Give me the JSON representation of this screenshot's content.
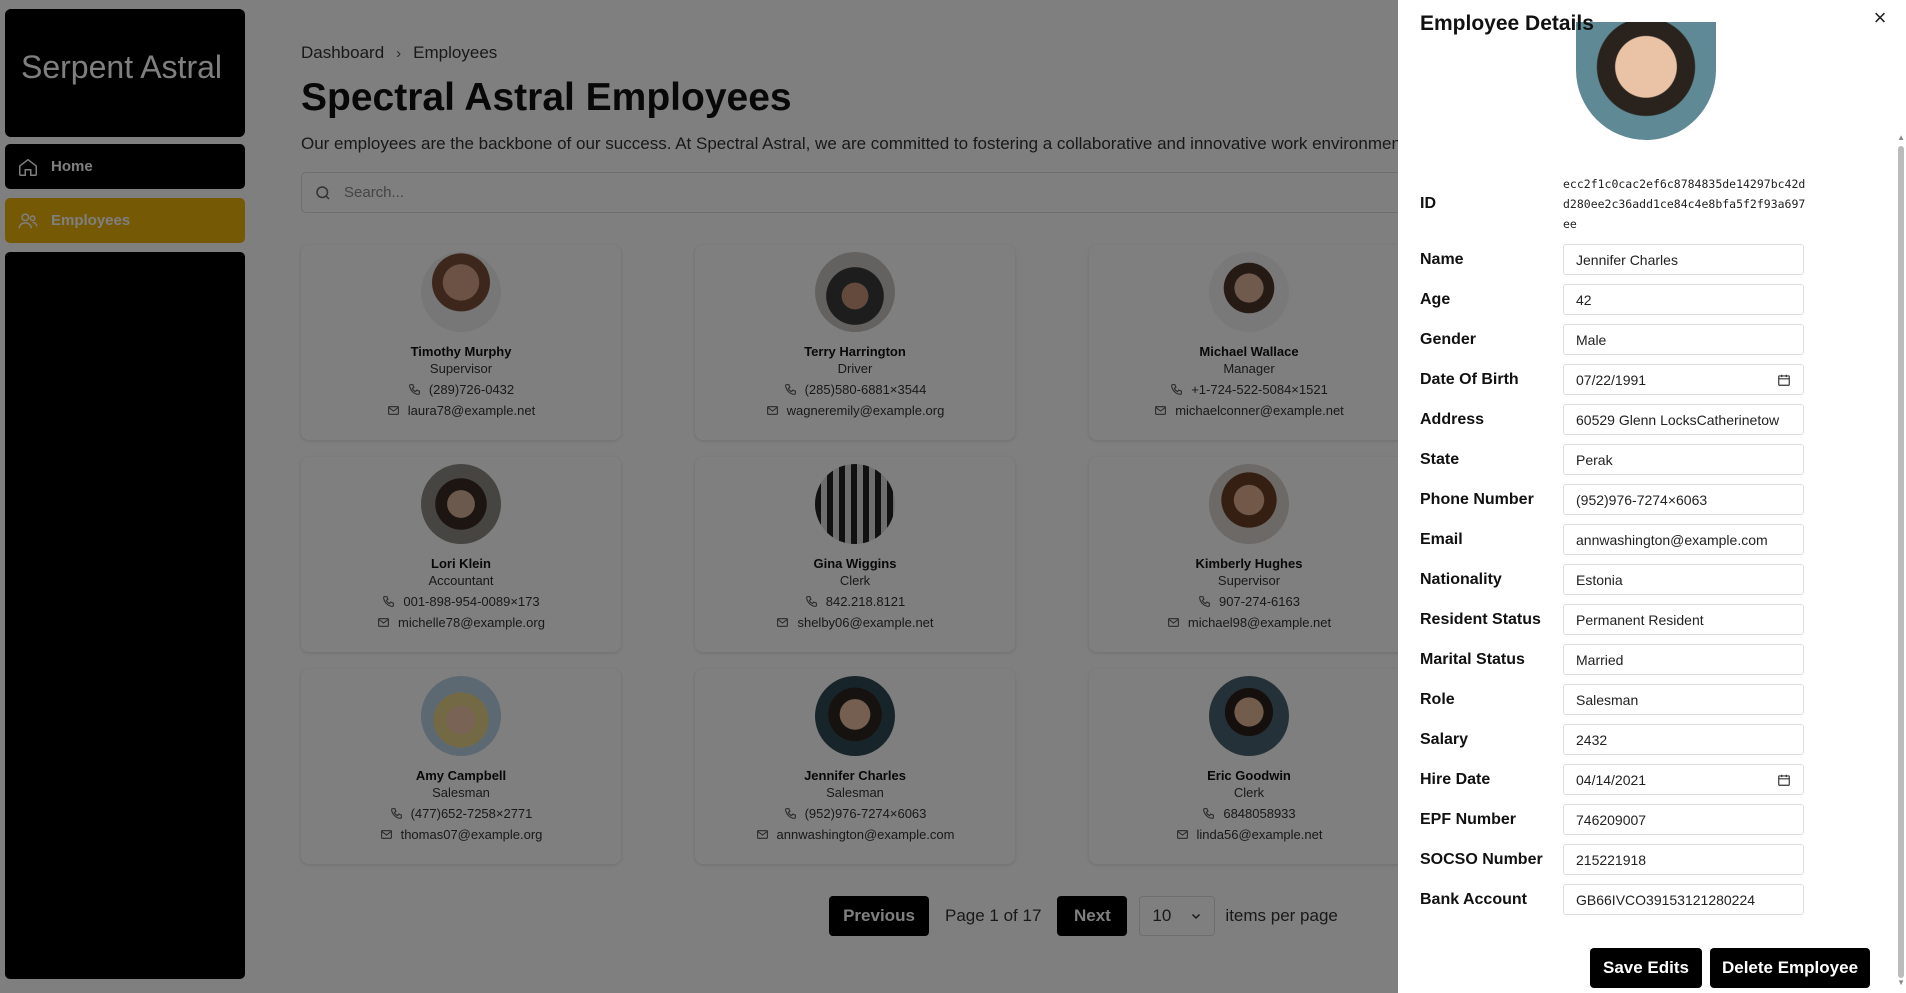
{
  "sidebar": {
    "brand": "Serpent Astral",
    "items": [
      {
        "label": "Home",
        "icon": "home-icon"
      },
      {
        "label": "Employees",
        "icon": "users-icon"
      }
    ],
    "active_color": "#eab308"
  },
  "breadcrumb": [
    "Dashboard",
    "Employees"
  ],
  "page": {
    "title": "Spectral Astral Employees",
    "intro": "Our employees are the backbone of our success. At Spectral Astral, we are committed to fostering a collaborative and innovative work environment"
  },
  "search": {
    "placeholder": "Search..."
  },
  "employees": [
    {
      "name": "Timothy Murphy",
      "role": "Supervisor",
      "phone": "(289)726-0432",
      "email": "laura78@example.net"
    },
    {
      "name": "Terry Harrington",
      "role": "Driver",
      "phone": "(285)580-6881×3544",
      "email": "wagneremily@example.org"
    },
    {
      "name": "Michael Wallace",
      "role": "Manager",
      "phone": "+1-724-522-5084×1521",
      "email": "michaelconner@example.net"
    },
    {
      "name": "Lori Klein",
      "role": "Accountant",
      "phone": "001-898-954-0089×173",
      "email": "michelle78@example.org"
    },
    {
      "name": "Gina Wiggins",
      "role": "Clerk",
      "phone": "842.218.8121",
      "email": "shelby06@example.net"
    },
    {
      "name": "Kimberly Hughes",
      "role": "Supervisor",
      "phone": "907-274-6163",
      "email": "michael98@example.net"
    },
    {
      "name": "Amy Campbell",
      "role": "Salesman",
      "phone": "(477)652-7258×2771",
      "email": "thomas07@example.org"
    },
    {
      "name": "Jennifer Charles",
      "role": "Salesman",
      "phone": "(952)976-7274×6063",
      "email": "annwashington@example.com"
    },
    {
      "name": "Eric Goodwin",
      "role": "Clerk",
      "phone": "6848058933",
      "email": "linda56@example.net"
    }
  ],
  "pagination": {
    "previous": "Previous",
    "info": "Page 1 of 17",
    "next": "Next",
    "per_page": "10",
    "per_page_label": "items per page"
  },
  "drawer": {
    "title": "Employee Details",
    "close": "×",
    "id_label": "ID",
    "id_value": "ecc2f1c0cac2ef6c8784835de14297bc42dd280ee2c36add1ce84c4e8bfa5f2f93a697ee",
    "fields": [
      {
        "label": "Name",
        "value": "Jennifer Charles"
      },
      {
        "label": "Age",
        "value": "42"
      },
      {
        "label": "Gender",
        "value": "Male"
      },
      {
        "label": "Date Of Birth",
        "value": "07/22/1991",
        "icon": "calendar-icon"
      },
      {
        "label": "Address",
        "value": "60529 Glenn LocksCatherinetow"
      },
      {
        "label": "State",
        "value": "Perak"
      },
      {
        "label": "Phone Number",
        "value": "(952)976-7274×6063"
      },
      {
        "label": "Email",
        "value": "annwashington@example.com"
      },
      {
        "label": "Nationality",
        "value": "Estonia"
      },
      {
        "label": "Resident Status",
        "value": "Permanent Resident"
      },
      {
        "label": "Marital Status",
        "value": "Married"
      },
      {
        "label": "Role",
        "value": "Salesman"
      },
      {
        "label": "Salary",
        "value": "2432"
      },
      {
        "label": "Hire Date",
        "value": "04/14/2021",
        "icon": "calendar-icon"
      },
      {
        "label": "EPF Number",
        "value": "746209007"
      },
      {
        "label": "SOCSO Number",
        "value": "215221918"
      },
      {
        "label": "Bank Account",
        "value": "GB66IVCO39153121280224"
      }
    ],
    "save": "Save Edits",
    "delete": "Delete Employee"
  }
}
